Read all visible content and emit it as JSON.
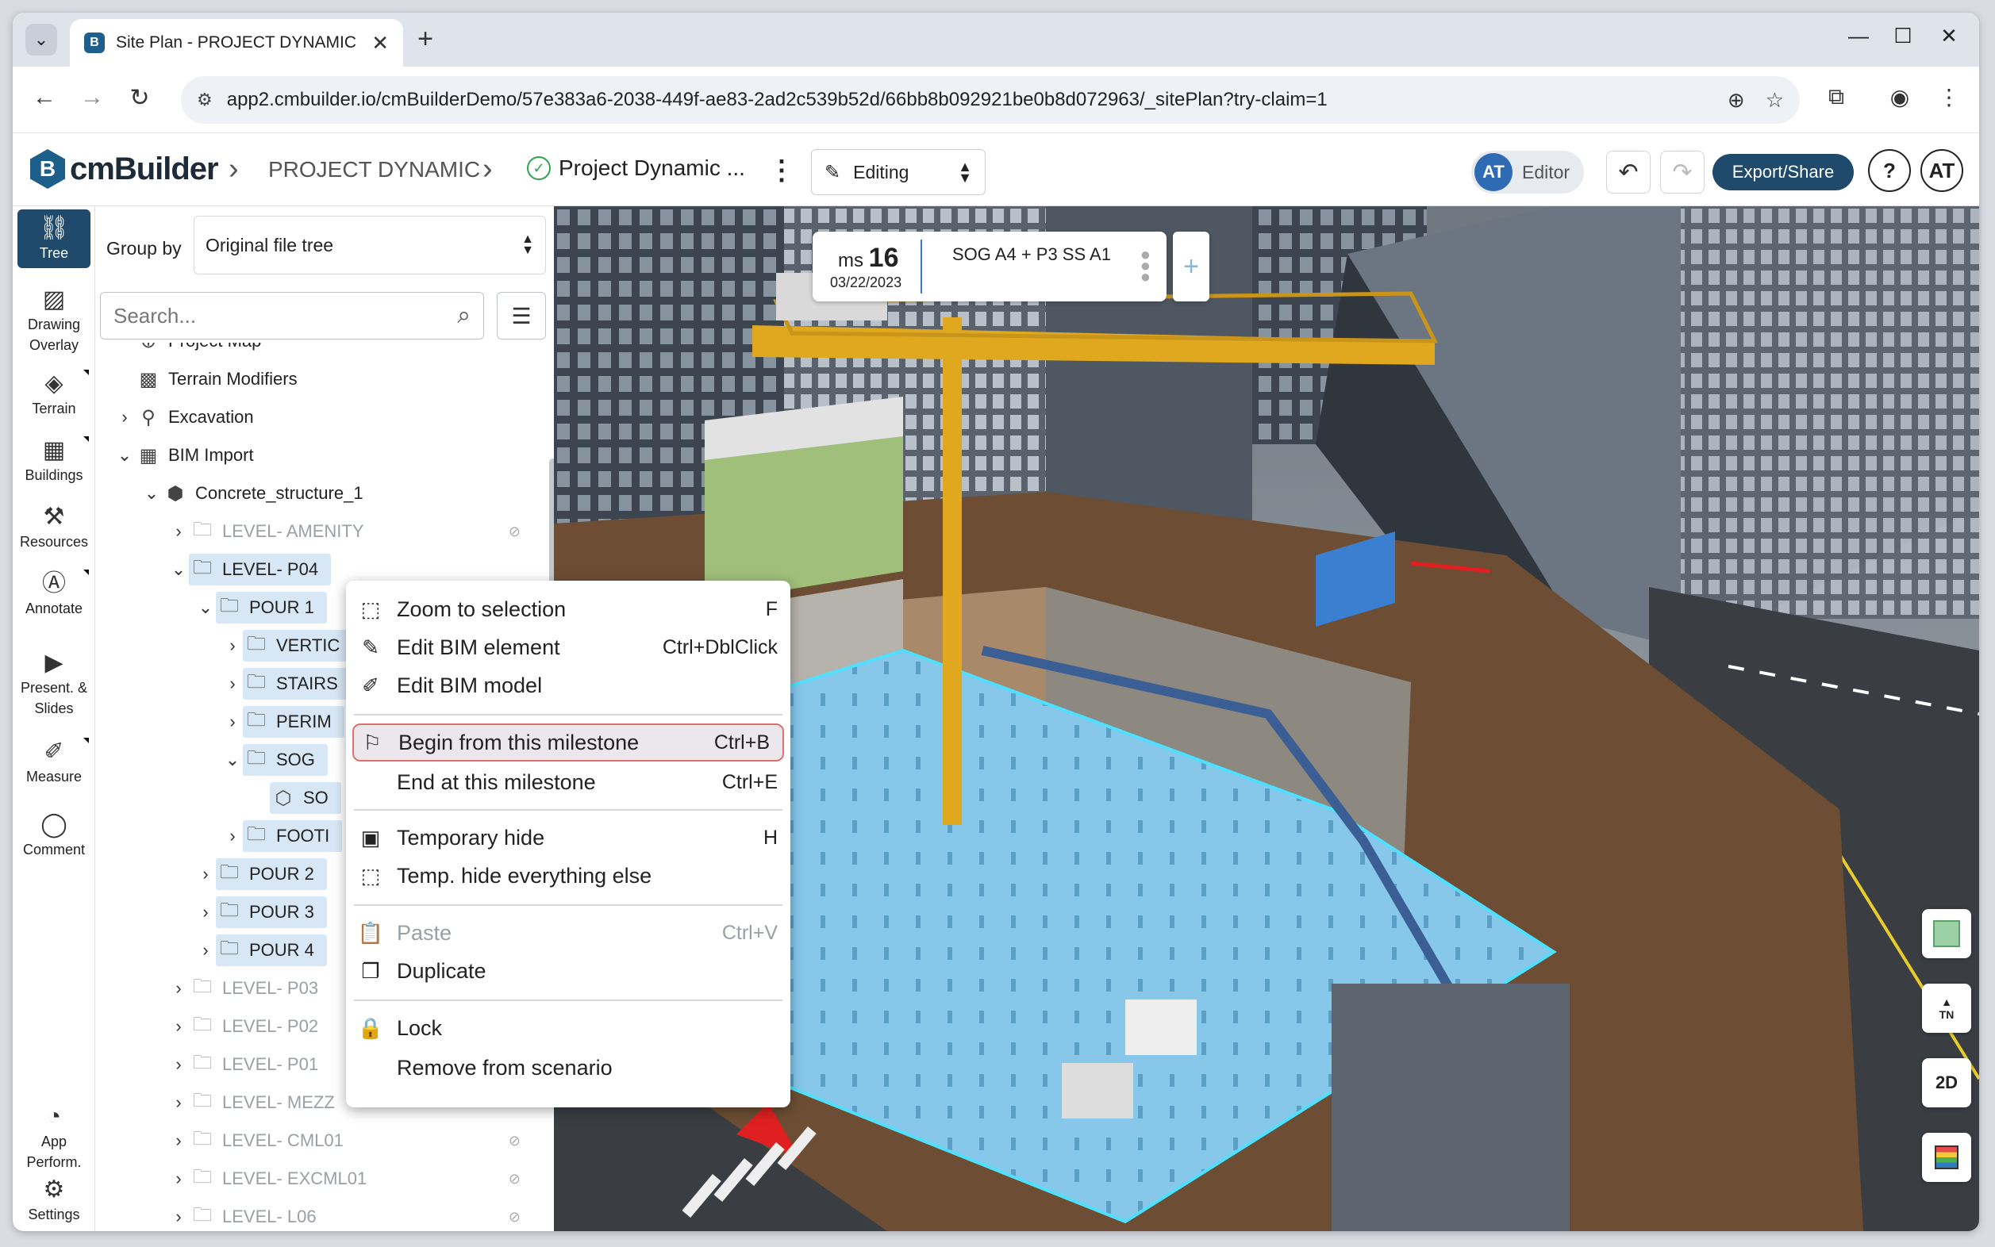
{
  "browser": {
    "tab_title": "Site Plan - PROJECT DYNAMIC |",
    "favicon": "cmBuilder-logo-icon",
    "url": "app2.cmbuilder.io/cmBuilderDemo/57e383a6-2038-449f-ae83-2ad2c539b52d/66bb8b092921be0b8d072963/_sitePlan?try-claim=1"
  },
  "header": {
    "logo_text": "cmBuilder",
    "breadcrumb_project": "PROJECT DYNAMIC",
    "breadcrumb_plan": "Project Dynamic ...",
    "mode": "Editing",
    "user_initials": "AT",
    "role": "Editor",
    "export_label": "Export/Share",
    "help_label": "?",
    "accent_color": "#1f4a6b"
  },
  "toolbar": [
    {
      "label": "Tree",
      "icon": "tree-icon"
    },
    {
      "label": "Drawing\nOverlay",
      "icon": "image-icon"
    },
    {
      "label": "Terrain",
      "icon": "terrain-icon"
    },
    {
      "label": "Buildings",
      "icon": "building-icon"
    },
    {
      "label": "Resources",
      "icon": "resources-icon"
    },
    {
      "label": "Annotate",
      "icon": "annotate-icon"
    },
    {
      "label": "Present. &\nSlides",
      "icon": "presentation-icon"
    },
    {
      "label": "Measure",
      "icon": "ruler-icon"
    },
    {
      "label": "Comment",
      "icon": "comment-icon"
    },
    {
      "label": "App\nPerform.",
      "icon": "gauge-icon"
    },
    {
      "label": "Settings",
      "icon": "gear-icon"
    }
  ],
  "panel": {
    "group_by_label": "Group by",
    "group_by_value": "Original file tree",
    "search_placeholder": "Search...",
    "tree": [
      {
        "label": "Project Map",
        "depth": 1
      },
      {
        "label": "Terrain Modifiers",
        "depth": 1
      },
      {
        "label": "Excavation",
        "depth": 1
      },
      {
        "label": "BIM Import",
        "depth": 1
      },
      {
        "label": "Concrete_structure_1",
        "depth": 2
      },
      {
        "label": "LEVEL- AMENITY",
        "depth": 3
      },
      {
        "label": "LEVEL- P04",
        "depth": 3
      },
      {
        "label": "POUR 1",
        "depth": 4
      },
      {
        "label": "VERTIC",
        "depth": 5
      },
      {
        "label": "STAIRS",
        "depth": 5
      },
      {
        "label": "PERIM",
        "depth": 5
      },
      {
        "label": "SOG",
        "depth": 5
      },
      {
        "label": "SO",
        "depth": 6
      },
      {
        "label": "FOOTI",
        "depth": 5
      },
      {
        "label": "POUR 2",
        "depth": 4
      },
      {
        "label": "POUR 3",
        "depth": 4
      },
      {
        "label": "POUR 4",
        "depth": 4
      },
      {
        "label": "LEVEL- P03",
        "depth": 3
      },
      {
        "label": "LEVEL- P02",
        "depth": 3
      },
      {
        "label": "LEVEL- P01",
        "depth": 3
      },
      {
        "label": "LEVEL- MEZZ",
        "depth": 3
      },
      {
        "label": "LEVEL- CML01",
        "depth": 3
      },
      {
        "label": "LEVEL- EXCML01",
        "depth": 3
      },
      {
        "label": "LEVEL- L06",
        "depth": 3
      }
    ]
  },
  "milestone": {
    "prefix": "ms",
    "number": "16",
    "date": "03/22/2023",
    "name": "SOG A4 + P3 SS A1"
  },
  "context_menu": [
    {
      "label": "Zoom to selection",
      "shortcut": "F",
      "icon": "zoom-selection-icon"
    },
    {
      "label": "Edit BIM element",
      "shortcut": "Ctrl+DblClick",
      "icon": "pencil-icon"
    },
    {
      "label": "Edit BIM model",
      "shortcut": "",
      "icon": "edit-model-icon"
    },
    {
      "label": "Begin from this milestone",
      "shortcut": "Ctrl+B",
      "icon": "flag-icon"
    },
    {
      "label": "End at this milestone",
      "shortcut": "Ctrl+E",
      "icon": ""
    },
    {
      "label": "Temporary hide",
      "shortcut": "H",
      "icon": "hide-icon"
    },
    {
      "label": "Temp. hide everything else",
      "shortcut": "",
      "icon": "hide-others-icon"
    },
    {
      "label": "Paste",
      "shortcut": "Ctrl+V",
      "icon": "clipboard-icon"
    },
    {
      "label": "Duplicate",
      "shortcut": "",
      "icon": "duplicate-icon"
    },
    {
      "label": "Lock",
      "shortcut": "",
      "icon": "lock-icon"
    },
    {
      "label": "Remove from scenario",
      "shortcut": "",
      "icon": ""
    }
  ],
  "viewport_buttons": {
    "map_icon": "map-icon",
    "north_label": "TN",
    "view_mode": "2D",
    "layers_icon": "layers-icon"
  }
}
